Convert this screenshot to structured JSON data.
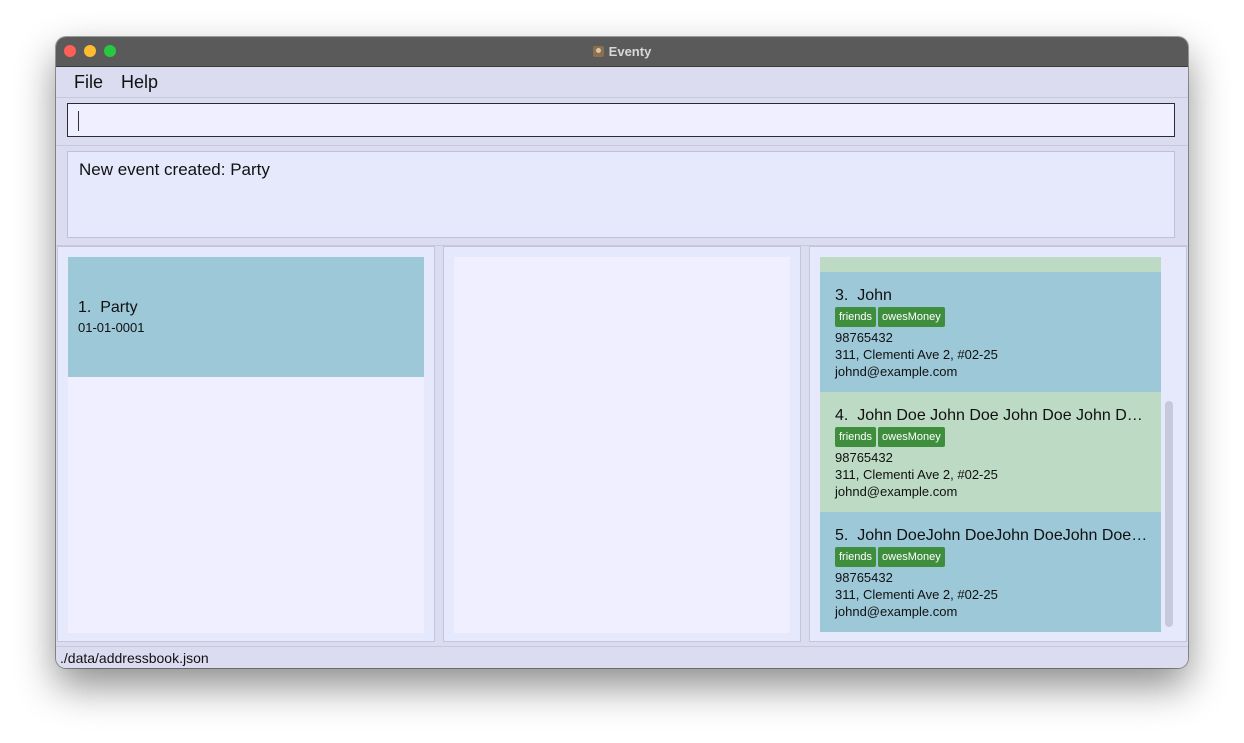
{
  "window": {
    "title": "Eventy"
  },
  "menu": {
    "items": [
      "File",
      "Help"
    ]
  },
  "command_box": {
    "value": "",
    "placeholder": ""
  },
  "result": {
    "text": "New event created: Party"
  },
  "events": [
    {
      "index": "1.",
      "name": "Party",
      "date": "01-01-0001"
    }
  ],
  "persons": [
    {
      "index": "3.",
      "name": "John",
      "tags": [
        "friends",
        "owesMoney"
      ],
      "phone": "98765432",
      "address": "311, Clementi Ave 2, #02-25",
      "email": "johnd@example.com"
    },
    {
      "index": "4.",
      "name": "John Doe John Doe John Doe John Doe John Doe",
      "tags": [
        "friends",
        "owesMoney"
      ],
      "phone": "98765432",
      "address": "311, Clementi Ave 2, #02-25",
      "email": "johnd@example.com"
    },
    {
      "index": "5.",
      "name": "John DoeJohn DoeJohn DoeJohn DoeJohn Doe",
      "tags": [
        "friends",
        "owesMoney"
      ],
      "phone": "98765432",
      "address": "311, Clementi Ave 2, #02-25",
      "email": "johnd@example.com"
    }
  ],
  "status": {
    "file_path": "./data/addressbook.json"
  },
  "colors": {
    "card_blue": "#9cc8d8",
    "card_green": "#bcdac4",
    "tag_green": "#3e8e3e"
  }
}
